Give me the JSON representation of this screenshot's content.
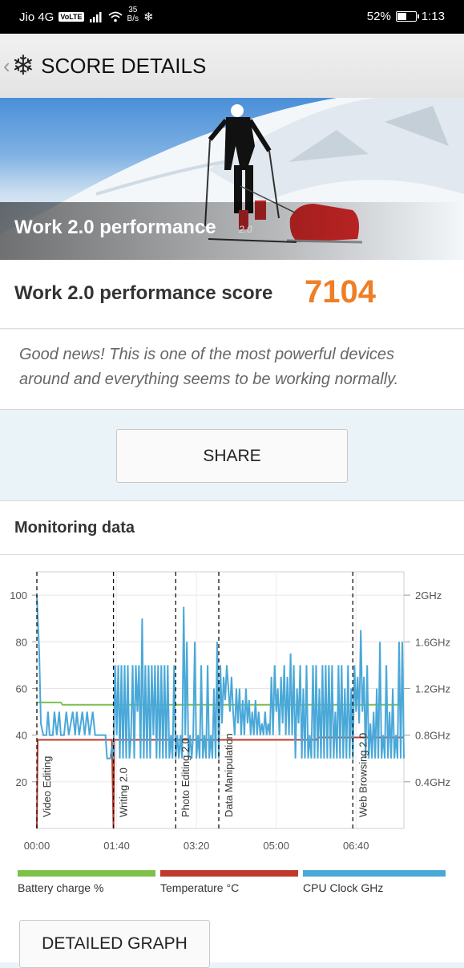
{
  "status_bar": {
    "carrier": "Jio 4G",
    "volte": "VoLTE",
    "speed_value": "35",
    "speed_unit": "B/s",
    "battery": "52%",
    "battery_level": 0.52,
    "time": "1:13"
  },
  "app_bar": {
    "title": "SCORE DETAILS",
    "back_icon": "chevron-left-icon",
    "logo_icon": "snowflake-icon"
  },
  "hero": {
    "title": "Work 2.0 performance",
    "version": "2.0"
  },
  "score": {
    "label": "Work 2.0 performance score",
    "value": "7104",
    "accent_color": "#f07e26"
  },
  "message": "Good news! This is one of the most powerful devices around and everything seems to be working normally.",
  "share_label": "SHARE",
  "monitoring": {
    "title": "Monitoring data",
    "detailed_graph_label": "DETAILED GRAPH",
    "legend": [
      {
        "label": "Battery charge %",
        "color": "#7cc24a"
      },
      {
        "label": "Temperature °C",
        "color": "#c0392b"
      },
      {
        "label": "CPU Clock GHz",
        "color": "#4aa8d8"
      }
    ]
  },
  "chart_data": {
    "type": "line",
    "x_tick_labels": [
      "00:00",
      "01:40",
      "03:20",
      "05:00",
      "06:40"
    ],
    "x_ticks_seconds": [
      0,
      100,
      200,
      300,
      400
    ],
    "xlim_seconds": [
      0,
      460
    ],
    "y_left_ticks": [
      20,
      40,
      60,
      80,
      100
    ],
    "ylim_left": [
      0,
      110
    ],
    "y_right_tick_labels": [
      "0.4GHz",
      "0.8GHz",
      "1.2GHz",
      "1.6GHz",
      "2GHz"
    ],
    "y_right_ticks_ghz": [
      0.4,
      0.8,
      1.2,
      1.6,
      2.0
    ],
    "ylim_right_ghz": [
      0,
      2.2
    ],
    "grid": true,
    "phases": [
      {
        "name": "Video Editing",
        "start_s": 0
      },
      {
        "name": "Writing 2.0",
        "start_s": 96
      },
      {
        "name": "Photo Editing 2.0",
        "start_s": 174
      },
      {
        "name": "Data Manipulation",
        "start_s": 228
      },
      {
        "name": "Web Browsing 2.0",
        "start_s": 396
      }
    ],
    "series": [
      {
        "name": "Battery charge %",
        "axis": "left",
        "color": "#7cc24a",
        "points": [
          [
            0,
            54
          ],
          [
            30,
            54
          ],
          [
            32,
            53
          ],
          [
            460,
            53
          ]
        ]
      },
      {
        "name": "Temperature °C",
        "axis": "left",
        "color": "#c0392b",
        "points": [
          [
            0,
            0
          ],
          [
            1,
            38
          ],
          [
            94,
            38
          ],
          [
            96,
            0
          ],
          [
            97,
            38
          ],
          [
            310,
            38
          ],
          [
            350,
            38
          ],
          [
            352,
            39
          ],
          [
            460,
            39
          ]
        ]
      },
      {
        "name": "CPU Clock GHz",
        "axis": "right",
        "color": "#4aa8d8",
        "points": [
          [
            0,
            2.0
          ],
          [
            3,
            1.5
          ],
          [
            5,
            0.9
          ],
          [
            8,
            0.8
          ],
          [
            12,
            0.8
          ],
          [
            14,
            1.0
          ],
          [
            16,
            0.8
          ],
          [
            20,
            0.8
          ],
          [
            22,
            1.0
          ],
          [
            25,
            0.8
          ],
          [
            28,
            1.0
          ],
          [
            30,
            0.8
          ],
          [
            34,
            0.8
          ],
          [
            37,
            1.0
          ],
          [
            40,
            0.8
          ],
          [
            45,
            1.0
          ],
          [
            48,
            0.8
          ],
          [
            50,
            1.0
          ],
          [
            53,
            0.8
          ],
          [
            57,
            1.0
          ],
          [
            60,
            0.8
          ],
          [
            63,
            1.0
          ],
          [
            66,
            0.8
          ],
          [
            70,
            1.0
          ],
          [
            73,
            0.8
          ],
          [
            80,
            0.8
          ],
          [
            86,
            0.8
          ],
          [
            88,
            0.6
          ],
          [
            92,
            0.6
          ],
          [
            94,
            0.7
          ],
          [
            96,
            0.6
          ],
          [
            98,
            1.4
          ],
          [
            100,
            0.8
          ],
          [
            102,
            1.4
          ],
          [
            104,
            0.6
          ],
          [
            106,
            1.4
          ],
          [
            108,
            0.6
          ],
          [
            110,
            1.4
          ],
          [
            112,
            0.6
          ],
          [
            114,
            1.4
          ],
          [
            116,
            0.6
          ],
          [
            118,
            0.8
          ],
          [
            120,
            1.4
          ],
          [
            122,
            0.6
          ],
          [
            124,
            1.4
          ],
          [
            126,
            1.0
          ],
          [
            128,
            1.4
          ],
          [
            130,
            0.6
          ],
          [
            132,
            1.8
          ],
          [
            134,
            0.6
          ],
          [
            136,
            1.4
          ],
          [
            138,
            0.6
          ],
          [
            140,
            1.4
          ],
          [
            142,
            0.6
          ],
          [
            144,
            1.4
          ],
          [
            146,
            0.8
          ],
          [
            148,
            1.4
          ],
          [
            150,
            0.6
          ],
          [
            152,
            1.4
          ],
          [
            154,
            0.6
          ],
          [
            156,
            1.4
          ],
          [
            158,
            0.6
          ],
          [
            160,
            1.4
          ],
          [
            162,
            0.6
          ],
          [
            164,
            1.4
          ],
          [
            166,
            0.6
          ],
          [
            168,
            0.8
          ],
          [
            170,
            0.6
          ],
          [
            172,
            1.4
          ],
          [
            174,
            0.6
          ],
          [
            176,
            0.8
          ],
          [
            178,
            0.6
          ],
          [
            180,
            0.8
          ],
          [
            182,
            0.6
          ],
          [
            184,
            1.9
          ],
          [
            186,
            0.8
          ],
          [
            188,
            1.6
          ],
          [
            190,
            0.6
          ],
          [
            192,
            0.8
          ],
          [
            194,
            0.6
          ],
          [
            196,
            0.8
          ],
          [
            198,
            1.6
          ],
          [
            200,
            0.6
          ],
          [
            202,
            0.8
          ],
          [
            204,
            0.6
          ],
          [
            206,
            1.4
          ],
          [
            208,
            0.6
          ],
          [
            210,
            0.8
          ],
          [
            212,
            0.6
          ],
          [
            214,
            1.4
          ],
          [
            216,
            0.6
          ],
          [
            218,
            0.8
          ],
          [
            220,
            0.6
          ],
          [
            222,
            1.2
          ],
          [
            224,
            0.6
          ],
          [
            226,
            1.6
          ],
          [
            228,
            0.6
          ],
          [
            230,
            1.4
          ],
          [
            232,
            0.9
          ],
          [
            234,
            1.3
          ],
          [
            236,
            1.1
          ],
          [
            238,
            1.4
          ],
          [
            240,
            1.2
          ],
          [
            242,
            1.0
          ],
          [
            244,
            1.3
          ],
          [
            246,
            1.0
          ],
          [
            248,
            0.8
          ],
          [
            250,
            1.2
          ],
          [
            252,
            0.9
          ],
          [
            254,
            1.2
          ],
          [
            256,
            0.8
          ],
          [
            258,
            1.1
          ],
          [
            260,
            0.8
          ],
          [
            262,
            1.2
          ],
          [
            264,
            0.9
          ],
          [
            266,
            1.1
          ],
          [
            268,
            0.8
          ],
          [
            270,
            1.0
          ],
          [
            272,
            0.8
          ],
          [
            274,
            1.1
          ],
          [
            276,
            0.8
          ],
          [
            278,
            1.0
          ],
          [
            280,
            0.8
          ],
          [
            282,
            0.9
          ],
          [
            284,
            0.8
          ],
          [
            286,
            1.0
          ],
          [
            288,
            0.8
          ],
          [
            290,
            0.9
          ],
          [
            292,
            0.8
          ],
          [
            294,
            1.3
          ],
          [
            296,
            0.8
          ],
          [
            298,
            1.4
          ],
          [
            300,
            1.0
          ],
          [
            302,
            1.2
          ],
          [
            304,
            0.8
          ],
          [
            306,
            1.3
          ],
          [
            308,
            0.9
          ],
          [
            310,
            1.4
          ],
          [
            312,
            0.8
          ],
          [
            314,
            1.3
          ],
          [
            316,
            0.8
          ],
          [
            318,
            1.5
          ],
          [
            320,
            0.8
          ],
          [
            322,
            1.4
          ],
          [
            324,
            0.6
          ],
          [
            326,
            1.2
          ],
          [
            328,
            0.9
          ],
          [
            330,
            1.4
          ],
          [
            332,
            0.6
          ],
          [
            334,
            1.2
          ],
          [
            336,
            0.6
          ],
          [
            338,
            1.4
          ],
          [
            340,
            0.6
          ],
          [
            342,
            0.8
          ],
          [
            344,
            0.6
          ],
          [
            346,
            1.4
          ],
          [
            348,
            0.6
          ],
          [
            350,
            1.4
          ],
          [
            352,
            0.6
          ],
          [
            354,
            1.2
          ],
          [
            356,
            0.6
          ],
          [
            358,
            1.4
          ],
          [
            360,
            0.6
          ],
          [
            362,
            1.4
          ],
          [
            364,
            0.6
          ],
          [
            366,
            1.4
          ],
          [
            368,
            0.6
          ],
          [
            370,
            1.4
          ],
          [
            372,
            0.6
          ],
          [
            374,
            1.0
          ],
          [
            376,
            0.6
          ],
          [
            378,
            1.4
          ],
          [
            380,
            0.6
          ],
          [
            382,
            1.4
          ],
          [
            384,
            0.6
          ],
          [
            386,
            1.2
          ],
          [
            388,
            0.6
          ],
          [
            390,
            1.4
          ],
          [
            392,
            0.6
          ],
          [
            394,
            1.2
          ],
          [
            396,
            0.6
          ],
          [
            398,
            1.4
          ],
          [
            400,
            1.0
          ],
          [
            402,
            1.3
          ],
          [
            404,
            0.9
          ],
          [
            406,
            1.7
          ],
          [
            408,
            1.0
          ],
          [
            410,
            1.3
          ],
          [
            412,
            0.6
          ],
          [
            414,
            1.4
          ],
          [
            416,
            0.6
          ],
          [
            418,
            0.9
          ],
          [
            420,
            0.6
          ],
          [
            422,
            1.0
          ],
          [
            424,
            0.6
          ],
          [
            426,
            1.2
          ],
          [
            428,
            0.6
          ],
          [
            430,
            1.6
          ],
          [
            432,
            0.6
          ],
          [
            434,
            0.8
          ],
          [
            436,
            0.6
          ],
          [
            438,
            1.4
          ],
          [
            440,
            0.6
          ],
          [
            442,
            1.0
          ],
          [
            444,
            0.6
          ],
          [
            446,
            1.2
          ],
          [
            448,
            0.6
          ],
          [
            450,
            0.8
          ],
          [
            452,
            0.6
          ],
          [
            454,
            1.6
          ],
          [
            456,
            0.6
          ],
          [
            458,
            1.6
          ],
          [
            460,
            0.6
          ]
        ]
      }
    ]
  }
}
